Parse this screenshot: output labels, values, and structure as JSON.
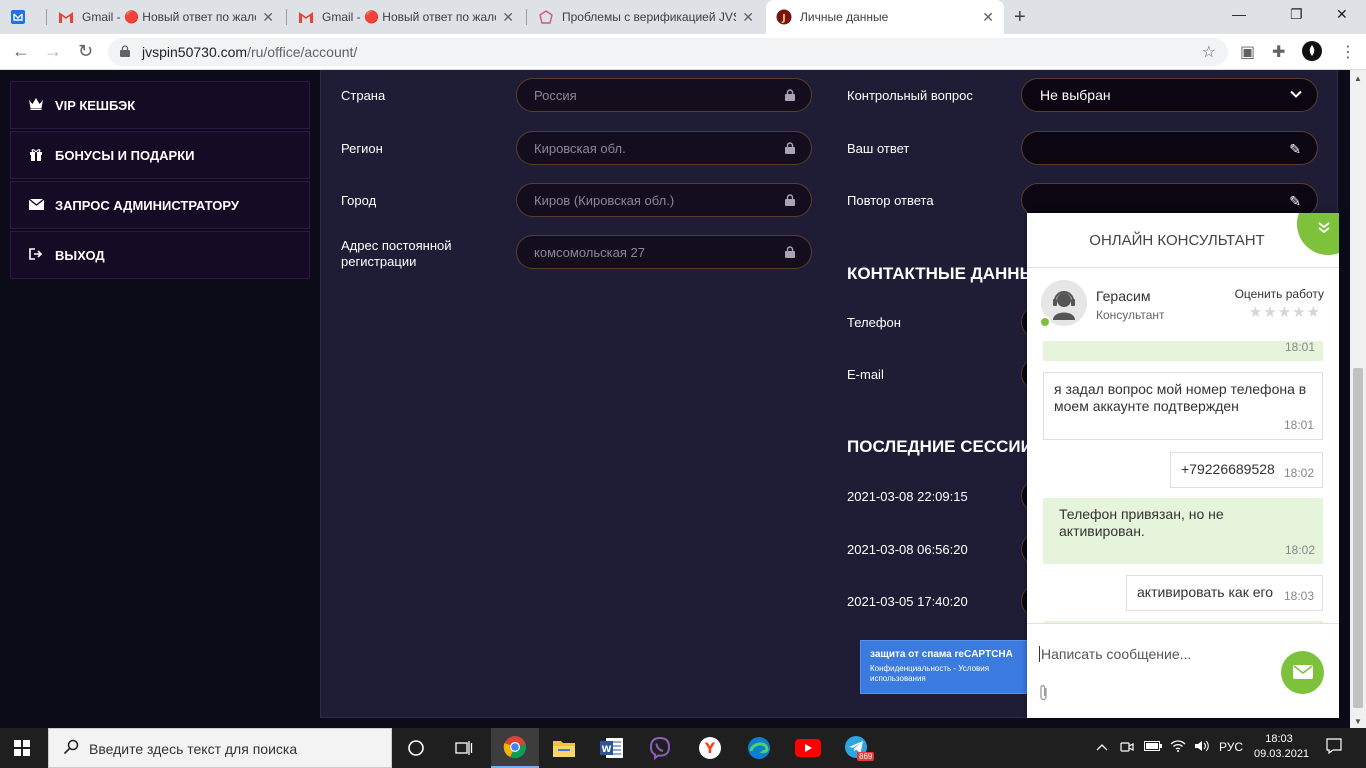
{
  "browser": {
    "tabs": [
      {
        "title": "",
        "icon": "mail-app-icon",
        "color": "#1a73e8"
      },
      {
        "title": "Gmail - 🔴 Новый ответ по жалобе",
        "icon": "gmail-icon"
      },
      {
        "title": "Gmail - 🔴 Новый ответ по жалобе",
        "icon": "gmail-icon"
      },
      {
        "title": "Проблемы с верификацией JVSPIN",
        "icon": "forum-icon"
      },
      {
        "title": "Личные данные",
        "icon": "jvspin-icon",
        "active": true
      }
    ],
    "url_domain": "jvspin50730.com",
    "url_path": "/ru/office/account/"
  },
  "sidebar": {
    "items": [
      {
        "label": "VIP КЕШБЭК",
        "icon": "crown-icon"
      },
      {
        "label": "БОНУСЫ И ПОДАРКИ",
        "icon": "gift-icon"
      },
      {
        "label": "ЗАПРОС АДМИНИСТРАТОРУ",
        "icon": "envelope-icon"
      },
      {
        "label": "ВЫХОД",
        "icon": "exit-icon"
      }
    ]
  },
  "form": {
    "country_label": "Страна",
    "country_value": "Россия",
    "region_label": "Регион",
    "region_value": "Кировская обл.",
    "city_label": "Город",
    "city_value": "Киров (Кировская обл.)",
    "address_label": "Адрес постоянной регистрации",
    "address_value": "комсомольская 27",
    "security_question_label": "Контрольный вопрос",
    "security_question_value": "Не выбран",
    "answer_label": "Ваш ответ",
    "answer_repeat_label": "Повтор ответа"
  },
  "contacts": {
    "title": "КОНТАКТНЫЕ ДАННЫЕ",
    "phone_label": "Телефон",
    "email_label": "E-mail"
  },
  "sessions": {
    "title": "ПОСЛЕДНИЕ СЕССИИ",
    "items": [
      "2021-03-08 22:09:15",
      "2021-03-08 06:56:20",
      "2021-03-05 17:40:20"
    ]
  },
  "recaptcha": {
    "title": "защита от спама reCAPTCHA",
    "links": "Конфиденциальность - Условия использования"
  },
  "chat": {
    "title": "ОНЛАЙН КОНСУЛЬТАНТ",
    "agent_name": "Герасим",
    "agent_role": "Консультант",
    "rate_label": "Оценить работу",
    "messages": [
      {
        "text": "",
        "time": "18:01",
        "side": "in"
      },
      {
        "text": "я задал вопрос мой номер телефона в моем аккаунте подтвержден",
        "time": "18:01",
        "side": "out"
      },
      {
        "text": "+79226689528",
        "time": "18:02",
        "side": "out"
      },
      {
        "text": "Телефон привязан, но не активирован.",
        "time": "18:02",
        "side": "in"
      },
      {
        "text": "активировать как его",
        "time": "18:03",
        "side": "out"
      }
    ],
    "input_placeholder": "Написать сообщение...",
    "accent": "#7dc23a"
  },
  "taskbar": {
    "search_placeholder": "Введите здесь текст для поиска",
    "language": "РУС",
    "time": "18:03",
    "date": "09.03.2021",
    "telegram_badge": "869"
  }
}
